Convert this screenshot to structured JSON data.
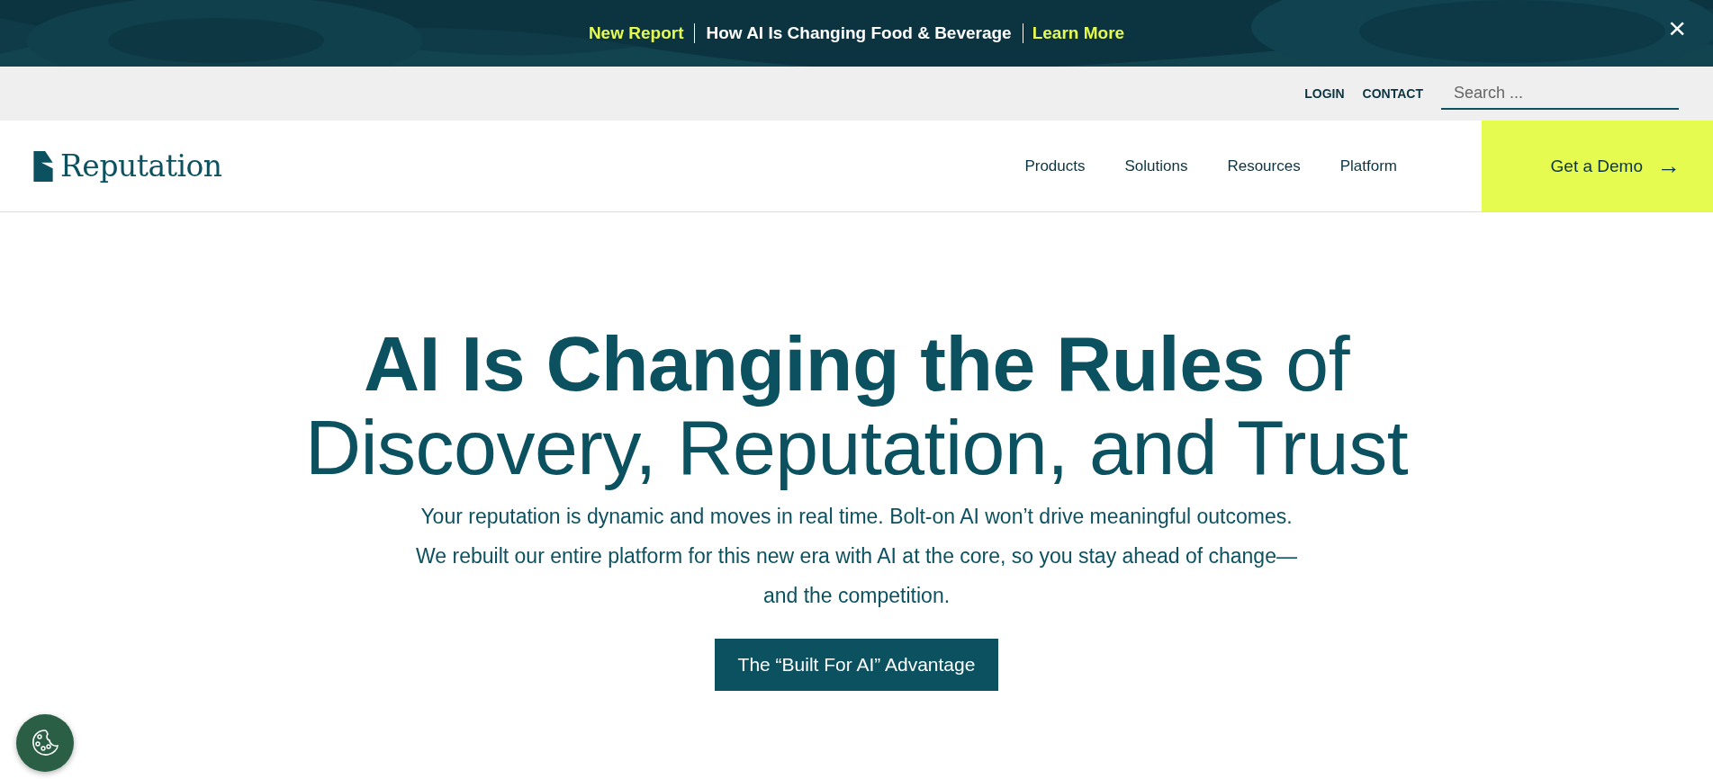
{
  "announcement": {
    "label": "New Report",
    "title": "How AI Is Changing Food & Beverage",
    "link": "Learn More",
    "close": "×"
  },
  "utility_nav": {
    "links": [
      "LOGIN",
      "CONTACT"
    ],
    "search": {
      "placeholder": "Search ..."
    }
  },
  "header": {
    "logo": "Reputation",
    "menu": [
      {
        "label": "Products"
      },
      {
        "label": "Solutions"
      },
      {
        "label": "Resources"
      },
      {
        "label": "Platform"
      }
    ],
    "cta": {
      "label": "Get a Demo",
      "arrow": "→"
    }
  },
  "hero": {
    "heading": "**AI Is Changing the Rules** of Discovery, Reputation, and Trust",
    "text": "Your reputation is dynamic and moves in real time. Bolt-on AI won’t drive meaningful outcomes. We rebuilt our entire platform for this new era with AI at the core, so you stay ahead of change—and the competition.",
    "button": "The “Built For AI” Advantage"
  }
}
